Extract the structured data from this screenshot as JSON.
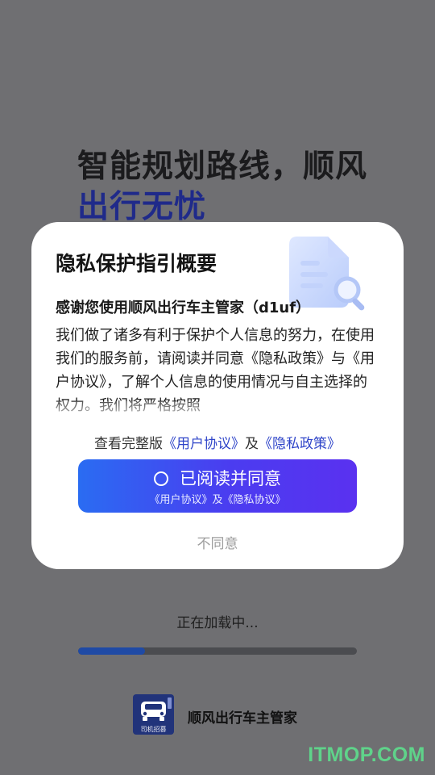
{
  "splash": {
    "headline_line1": "智能规划路线，顺风",
    "headline_line2": "出行无忧",
    "loading_text": "正在加载中...",
    "loading_progress": 0.24,
    "logo_caption": "司机招募",
    "brand_name": "顺风出行车主管家"
  },
  "modal": {
    "title": "隐私保护指引概要",
    "intro_title": "感谢您使用顺风出行车主管家（d1uf）",
    "body": "我们做了诸多有利于保护个人信息的努力，在使用我们的服务前，请阅读并同意《隐私政策》与《用户协议》，了解个人信息的使用情况与自主选择的权力。我们将严格按照",
    "links_prefix": "查看完整版",
    "user_agreement_link": "《用户协议》",
    "links_and": "及",
    "privacy_policy_link": "《隐私政策》",
    "agree_label": "已阅读并同意",
    "agree_sublabel": "《用户协议》及《隐私协议》",
    "disagree_label": "不同意"
  },
  "watermark": "ITMOP.COM",
  "colors": {
    "overlay": "#6f6f72",
    "headline_accent": "#1f2a8a",
    "button_gradient_start": "#2a6cf2",
    "button_gradient_end": "#5a31f0",
    "link": "#2f45c9",
    "progress_fill": "#1f4aa5"
  },
  "icons": {
    "doc_illustration": "document-search-icon",
    "radio": "radio-unchecked-icon",
    "logo": "car-icon"
  }
}
